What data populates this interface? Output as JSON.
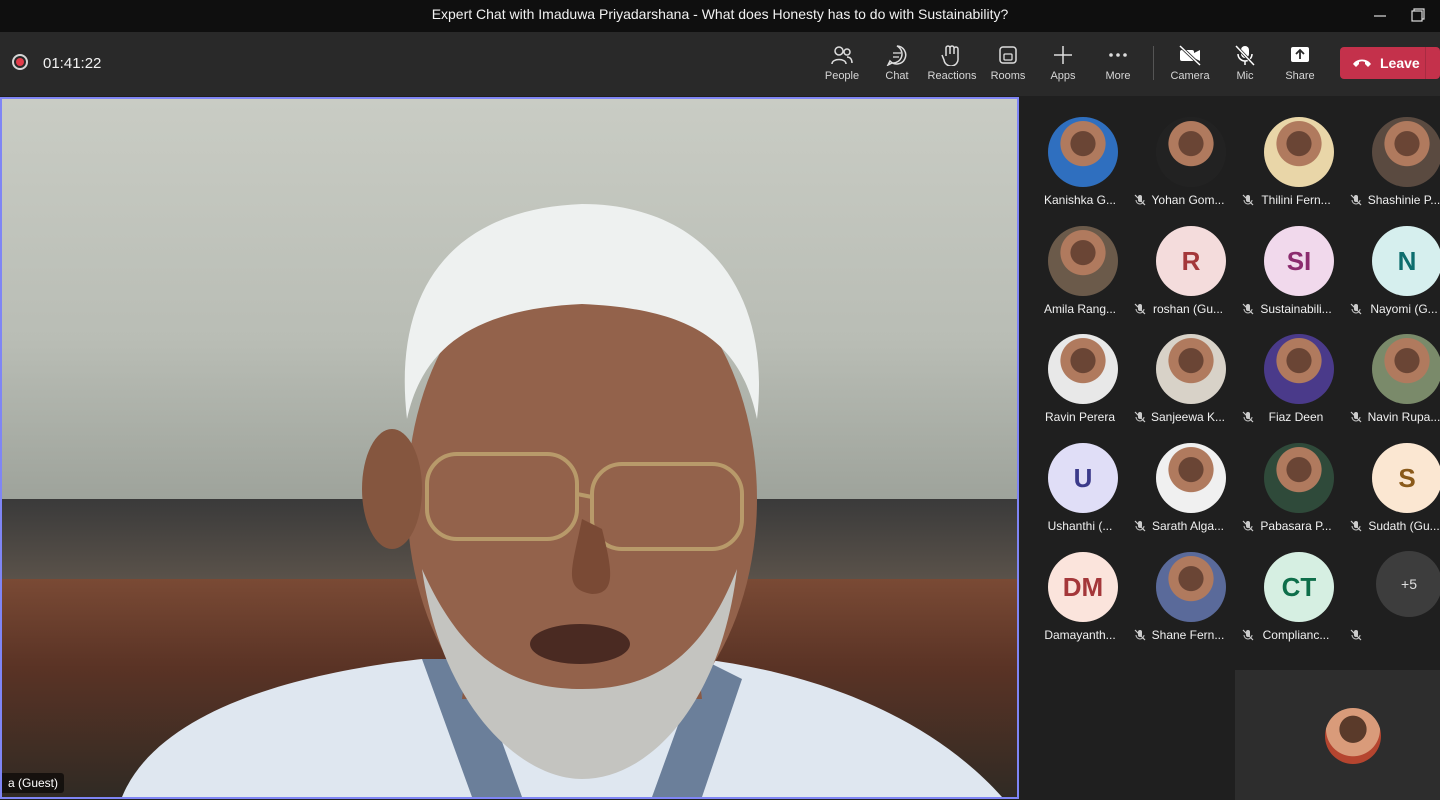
{
  "window": {
    "title": "Expert Chat with Imaduwa Priyadarshana - What does Honesty has to do with Sustainability?"
  },
  "toolbar": {
    "timer": "01:41:22",
    "buttons": [
      {
        "label": "People",
        "icon": "people-icon"
      },
      {
        "label": "Chat",
        "icon": "chat-icon"
      },
      {
        "label": "Reactions",
        "icon": "reactions-icon"
      },
      {
        "label": "Rooms",
        "icon": "rooms-icon"
      },
      {
        "label": "Apps",
        "icon": "plus-icon"
      },
      {
        "label": "More",
        "icon": "more-icon"
      },
      {
        "label": "Camera",
        "icon": "camera-off-icon"
      },
      {
        "label": "Mic",
        "icon": "mic-off-icon"
      },
      {
        "label": "Share",
        "icon": "share-icon"
      }
    ],
    "leave_label": "Leave"
  },
  "stage": {
    "speaker_label": "a (Guest)"
  },
  "participants": [
    {
      "name": "Kanishka G...",
      "initials": "",
      "color": "#2f6fbf",
      "photo": true
    },
    {
      "name": "Yohan Gom...",
      "initials": "",
      "color": "#222222",
      "photo": true
    },
    {
      "name": "Thilini Fern...",
      "initials": "",
      "color": "#e9d6a8",
      "photo": true
    },
    {
      "name": "Shashinie P...",
      "initials": "",
      "color": "#5a4a40",
      "photo": true
    },
    {
      "name": "Amila Rang...",
      "initials": "",
      "color": "#6b5a4a",
      "photo": true
    },
    {
      "name": "roshan (Gu...",
      "initials": "R",
      "color": "#f4dcdc",
      "text_color": "#a4373a",
      "photo": false
    },
    {
      "name": "Sustainabili...",
      "initials": "SI",
      "color": "#f1d9ec",
      "text_color": "#8b2b6e",
      "photo": false
    },
    {
      "name": "Nayomi (G...",
      "initials": "N",
      "color": "#d6efee",
      "text_color": "#0e6e6e",
      "photo": false
    },
    {
      "name": "Ravin Perera",
      "initials": "",
      "color": "#e8e8e8",
      "photo": true
    },
    {
      "name": "Sanjeewa K...",
      "initials": "",
      "color": "#d8d2c8",
      "photo": true
    },
    {
      "name": "Fiaz Deen",
      "initials": "",
      "color": "#4a3a8a",
      "photo": true
    },
    {
      "name": "Navin Rupa...",
      "initials": "",
      "color": "#7a8a6a",
      "photo": true
    },
    {
      "name": "Ushanthi (...",
      "initials": "U",
      "color": "#e0def7",
      "text_color": "#3b3a8a",
      "photo": false
    },
    {
      "name": "Sarath Alga...",
      "initials": "",
      "color": "#f0f0f0",
      "photo": true
    },
    {
      "name": "Pabasara P...",
      "initials": "",
      "color": "#2f4a3a",
      "photo": true
    },
    {
      "name": "Sudath (Gu...",
      "initials": "S",
      "color": "#fbe7d2",
      "text_color": "#8a5a1a",
      "photo": false
    },
    {
      "name": "Damayanth...",
      "initials": "DM",
      "color": "#fbe4dc",
      "text_color": "#a4373a",
      "photo": false
    },
    {
      "name": "Shane Fern...",
      "initials": "",
      "color": "#5a6a9a",
      "photo": true
    },
    {
      "name": "Complianc...",
      "initials": "CT",
      "color": "#d6efe2",
      "text_color": "#0e6e4a",
      "photo": false
    }
  ],
  "overflow_count": "+5",
  "colors": {
    "accent_border": "#7f85f5",
    "leave": "#c4314b",
    "recording": "#e23c4a"
  }
}
